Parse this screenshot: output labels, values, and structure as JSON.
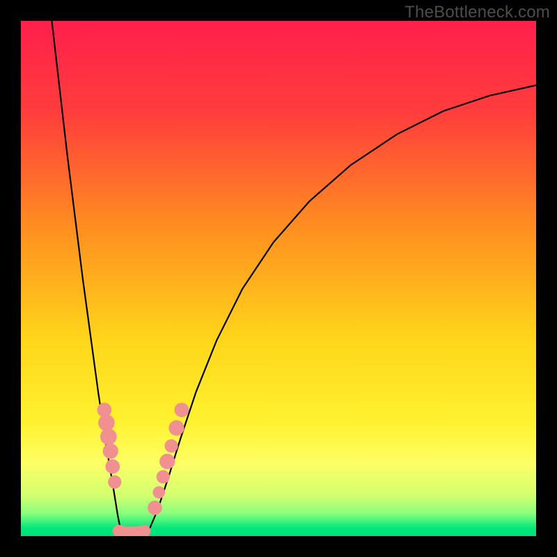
{
  "watermark": "TheBottleneck.com",
  "chart_data": {
    "type": "line",
    "title": "",
    "xlabel": "",
    "ylabel": "",
    "xlim": [
      0,
      100
    ],
    "ylim": [
      0,
      100
    ],
    "grid": false,
    "background_gradient": {
      "stops": [
        {
          "offset": 0.0,
          "color": "#ff1f4b"
        },
        {
          "offset": 0.18,
          "color": "#ff3e3c"
        },
        {
          "offset": 0.4,
          "color": "#ff8e20"
        },
        {
          "offset": 0.62,
          "color": "#ffd61a"
        },
        {
          "offset": 0.78,
          "color": "#fff230"
        },
        {
          "offset": 0.86,
          "color": "#fcff66"
        },
        {
          "offset": 0.92,
          "color": "#d4ff70"
        },
        {
          "offset": 0.955,
          "color": "#8cff7d"
        },
        {
          "offset": 0.985,
          "color": "#00e87a"
        },
        {
          "offset": 1.0,
          "color": "#00e07e"
        }
      ]
    },
    "series": [
      {
        "name": "curve-left",
        "x": [
          6.0,
          7.5,
          9.0,
          10.5,
          12.0,
          13.5,
          15.0,
          16.5,
          18.0,
          18.8,
          19.3
        ],
        "y": [
          100.0,
          87.0,
          74.0,
          62.0,
          50.0,
          39.0,
          28.0,
          18.0,
          9.0,
          4.0,
          1.5
        ]
      },
      {
        "name": "valley-floor",
        "x": [
          19.3,
          20.0,
          21.2,
          22.5,
          23.8,
          25.0
        ],
        "y": [
          1.5,
          0.8,
          0.5,
          0.5,
          0.8,
          1.5
        ]
      },
      {
        "name": "curve-right",
        "x": [
          25.0,
          26.5,
          28.5,
          31.0,
          34.0,
          38.0,
          43.0,
          49.0,
          56.0,
          64.0,
          73.0,
          82.0,
          91.0,
          100.0
        ],
        "y": [
          1.5,
          5.0,
          11.0,
          19.0,
          28.0,
          38.0,
          48.0,
          57.0,
          65.0,
          72.0,
          78.0,
          82.5,
          85.5,
          87.5
        ]
      }
    ],
    "markers": [
      {
        "x": 16.2,
        "y": 24.5,
        "r": 1.4
      },
      {
        "x": 16.6,
        "y": 22.0,
        "r": 1.6
      },
      {
        "x": 17.0,
        "y": 19.3,
        "r": 1.6
      },
      {
        "x": 17.4,
        "y": 16.5,
        "r": 1.5
      },
      {
        "x": 17.8,
        "y": 13.5,
        "r": 1.4
      },
      {
        "x": 18.2,
        "y": 10.5,
        "r": 1.3
      },
      {
        "x": 19.0,
        "y": 1.0,
        "r": 1.2
      },
      {
        "x": 20.0,
        "y": 0.8,
        "r": 1.2
      },
      {
        "x": 21.0,
        "y": 0.7,
        "r": 1.2
      },
      {
        "x": 22.0,
        "y": 0.7,
        "r": 1.2
      },
      {
        "x": 23.0,
        "y": 0.8,
        "r": 1.2
      },
      {
        "x": 24.0,
        "y": 1.0,
        "r": 1.2
      },
      {
        "x": 26.0,
        "y": 5.5,
        "r": 1.4
      },
      {
        "x": 26.8,
        "y": 8.5,
        "r": 1.2
      },
      {
        "x": 27.6,
        "y": 11.5,
        "r": 1.3
      },
      {
        "x": 28.4,
        "y": 14.5,
        "r": 1.5
      },
      {
        "x": 29.2,
        "y": 17.5,
        "r": 1.3
      },
      {
        "x": 30.2,
        "y": 21.0,
        "r": 1.5
      },
      {
        "x": 31.2,
        "y": 24.5,
        "r": 1.4
      }
    ],
    "marker_color": "#f09090",
    "curve_color": "#000000",
    "curve_width": 2.2
  }
}
